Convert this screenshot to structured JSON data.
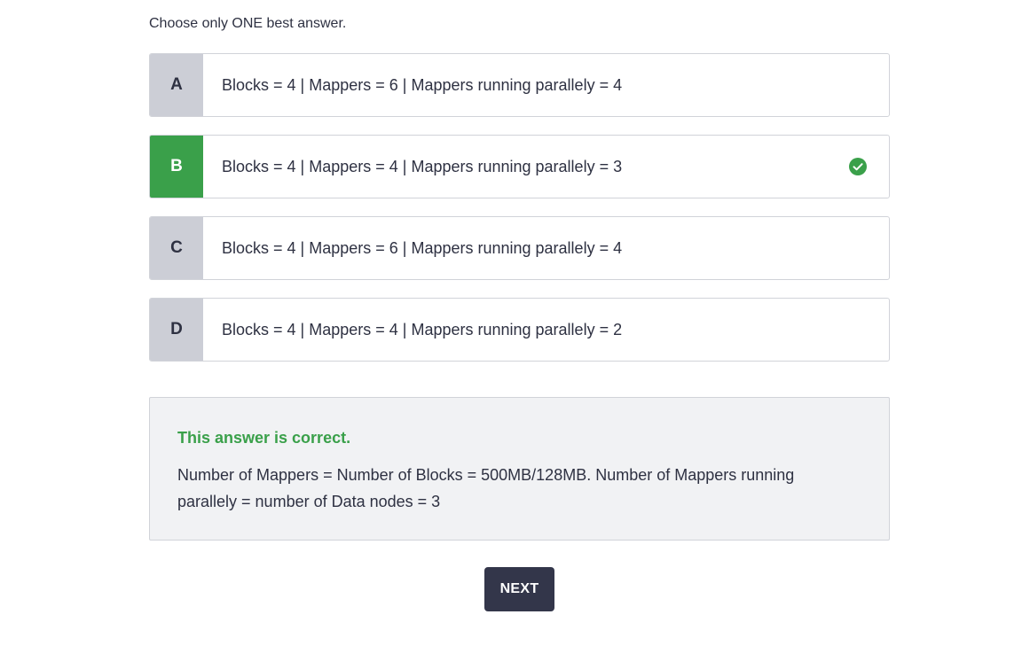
{
  "instruction": "Choose only ONE best answer.",
  "options": [
    {
      "letter": "A",
      "text": "Blocks = 4 | Mappers = 6 | Mappers running parallely = 4",
      "state": "default"
    },
    {
      "letter": "B",
      "text": "Blocks = 4 | Mappers = 4 | Mappers running parallely = 3",
      "state": "correct-selected"
    },
    {
      "letter": "C",
      "text": "Blocks = 4 | Mappers = 6 | Mappers running parallely = 4",
      "state": "default"
    },
    {
      "letter": "D",
      "text": "Blocks = 4 | Mappers = 4 | Mappers running parallely = 2",
      "state": "default"
    }
  ],
  "feedback": {
    "title": "This answer is correct.",
    "body": "Number of Mappers = Number of Blocks = 500MB/128MB. Number of Mappers running parallely = number of Data nodes = 3"
  },
  "next_button": {
    "label": "NEXT"
  },
  "icons": {
    "correct": "check-circle-icon"
  },
  "colors": {
    "correct": "#3aa04a",
    "letter_bg": "#ccced6",
    "button_bg": "#33364a",
    "feedback_bg": "#f1f2f4"
  }
}
